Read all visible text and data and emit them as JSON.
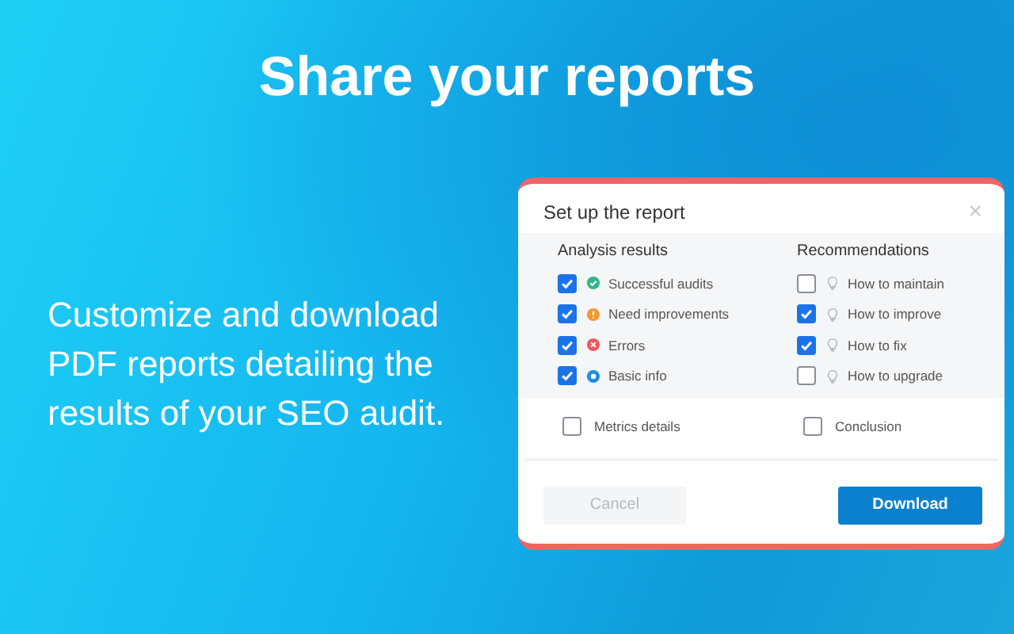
{
  "headline": "Share your reports",
  "description": "Customize and download PDF reports detailing the results of your SEO audit.",
  "dialog": {
    "title": "Set up the report",
    "close": "×",
    "columns": [
      {
        "heading": "Analysis results",
        "items": [
          {
            "label": "Successful audits",
            "kind": "success",
            "checked": true
          },
          {
            "label": "Need improvements",
            "kind": "warning",
            "checked": true
          },
          {
            "label": "Errors",
            "kind": "error",
            "checked": true
          },
          {
            "label": "Basic info",
            "kind": "info",
            "checked": true
          }
        ]
      },
      {
        "heading": "Recommendations",
        "items": [
          {
            "label": "How to maintain",
            "kind": "hint",
            "checked": false
          },
          {
            "label": "How to improve",
            "kind": "hint",
            "checked": true
          },
          {
            "label": "How to fix",
            "kind": "hint",
            "checked": true
          },
          {
            "label": "How to upgrade",
            "kind": "hint",
            "checked": false
          }
        ]
      }
    ],
    "extras": [
      {
        "label": "Metrics details",
        "checked": false
      },
      {
        "label": "Conclusion",
        "checked": false
      }
    ],
    "buttons": {
      "cancel": "Cancel",
      "download": "Download"
    }
  }
}
